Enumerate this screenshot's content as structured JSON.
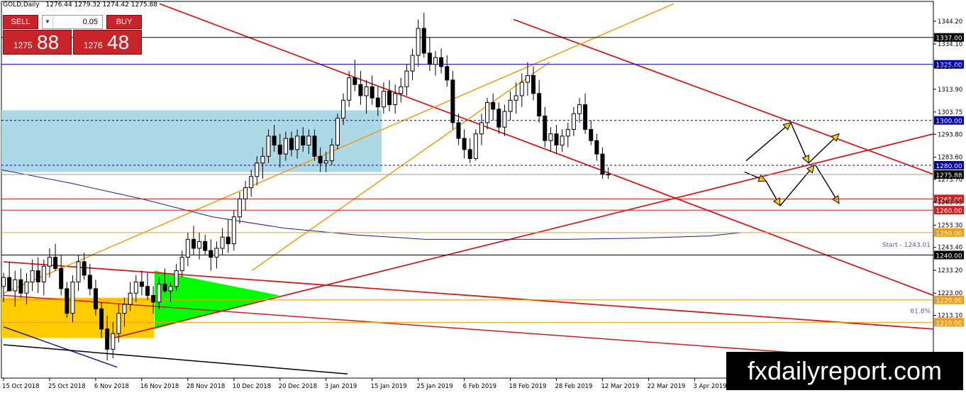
{
  "header": {
    "symbol_tf": "GOLD,Daily",
    "ohlc": "1276.44 1279.32 1274.42 1275.88"
  },
  "trade_panel": {
    "sell_label": "SELL",
    "buy_label": "BUY",
    "lot": "0.05",
    "sell_small": "1275",
    "sell_big": "88",
    "buy_small": "1276",
    "buy_big": "48",
    "down_arrow": "▼",
    "up_arrow": "▲"
  },
  "watermark": "fxdailyreport.com",
  "colors": {
    "bull": "#ffffff",
    "bear": "#000000",
    "red": "#d41c1c",
    "orange": "#f39c12",
    "navy": "#1c1c9c",
    "zone": "#add8e6",
    "green": "#00ff00",
    "yellow": "#ffcc00"
  },
  "chart_data": {
    "type": "candlestick",
    "ylim": [
      1185.13,
      1353.04
    ],
    "y_ticks": [
      "1344.20",
      "1334.10",
      "1323.95",
      "1313.90",
      "1303.75",
      "1293.80",
      "1283.60",
      "1273.70",
      "1263.55",
      "1253.30",
      "1243.40",
      "1233.20",
      "1223.00",
      "1213.10"
    ],
    "x_labels": [
      "15 Oct 2018",
      "25 Oct 2018",
      "6 Nov 2018",
      "16 Nov 2018",
      "28 Nov 2018",
      "10 Dec 2018",
      "20 Dec 2018",
      "3 Jan 2019",
      "15 Jan 2019",
      "25 Jan 2019",
      "6 Feb 2019",
      "18 Feb 2019",
      "28 Feb 2019",
      "12 Mar 2019",
      "22 Mar 2019",
      "3 Apr 2019"
    ],
    "x_label_index": [
      0,
      8,
      16,
      24,
      32,
      40,
      48,
      56,
      64,
      72,
      80,
      88,
      96,
      104,
      112,
      120
    ],
    "levels": [
      {
        "price": 1337.0,
        "label": "1337.00",
        "color": "#000000",
        "style": "solid"
      },
      {
        "price": 1325.0,
        "label": "1325.00",
        "color": "#0000cc",
        "style": "solid"
      },
      {
        "price": 1300.0,
        "label": "1300.00",
        "color": "#0000aa",
        "style": "dash"
      },
      {
        "price": 1280.0,
        "label": "1280.00",
        "color": "#0000aa",
        "style": "dash"
      },
      {
        "price": 1275.88,
        "label": "1275.88",
        "color": "#000000",
        "style": "current"
      },
      {
        "price": 1265.0,
        "label": "1265.00",
        "color": "#d41c1c",
        "style": "solid"
      },
      {
        "price": 1260.0,
        "label": "1260.00",
        "color": "#d41c1c",
        "style": "solid"
      },
      {
        "price": 1250.0,
        "label": "1250.00",
        "color": "#f39c12",
        "style": "solid"
      },
      {
        "price": 1240.0,
        "label": "1240.00",
        "color": "#000000",
        "style": "solid"
      },
      {
        "price": 1220.0,
        "label": "1220.00",
        "color": "#f39c12",
        "style": "solid"
      },
      {
        "price": 1210.0,
        "label": "1210.00",
        "color": "#f39c12",
        "style": "solid"
      }
    ],
    "annotations": [
      {
        "text": "Start - 1243.01",
        "price": 1243.01
      },
      {
        "text": "61.8%",
        "price": 1213.5
      }
    ],
    "candles": [
      [
        1226,
        1232,
        1219,
        1230
      ],
      [
        1230,
        1237,
        1226,
        1224
      ],
      [
        1224,
        1233,
        1217,
        1229
      ],
      [
        1229,
        1234,
        1221,
        1223
      ],
      [
        1223,
        1232,
        1218,
        1228
      ],
      [
        1228,
        1238,
        1224,
        1233
      ],
      [
        1233,
        1239,
        1223,
        1228
      ],
      [
        1228,
        1238,
        1222,
        1235
      ],
      [
        1235,
        1243,
        1230,
        1239
      ],
      [
        1239,
        1245,
        1233,
        1234
      ],
      [
        1234,
        1240,
        1222,
        1225
      ],
      [
        1225,
        1228,
        1212,
        1214
      ],
      [
        1214,
        1231,
        1210,
        1228
      ],
      [
        1228,
        1240,
        1224,
        1237
      ],
      [
        1237,
        1241,
        1229,
        1231
      ],
      [
        1231,
        1236,
        1222,
        1225
      ],
      [
        1225,
        1229,
        1213,
        1216
      ],
      [
        1216,
        1219,
        1203,
        1207
      ],
      [
        1207,
        1213,
        1193,
        1198
      ],
      [
        1198,
        1210,
        1194,
        1205
      ],
      [
        1205,
        1218,
        1201,
        1214
      ],
      [
        1214,
        1221,
        1208,
        1218
      ],
      [
        1218,
        1228,
        1215,
        1223
      ],
      [
        1223,
        1231,
        1219,
        1228
      ],
      [
        1228,
        1233,
        1222,
        1226
      ],
      [
        1226,
        1232,
        1220,
        1222
      ],
      [
        1222,
        1226,
        1214,
        1219
      ],
      [
        1219,
        1230,
        1216,
        1227
      ],
      [
        1227,
        1234,
        1223,
        1224
      ],
      [
        1224,
        1228,
        1219,
        1226
      ],
      [
        1226,
        1236,
        1224,
        1233
      ],
      [
        1233,
        1242,
        1230,
        1239
      ],
      [
        1239,
        1250,
        1235,
        1247
      ],
      [
        1247,
        1253,
        1240,
        1243
      ],
      [
        1243,
        1250,
        1238,
        1246
      ],
      [
        1246,
        1249,
        1240,
        1242
      ],
      [
        1242,
        1247,
        1233,
        1239
      ],
      [
        1239,
        1246,
        1234,
        1243
      ],
      [
        1243,
        1252,
        1240,
        1248
      ],
      [
        1248,
        1256,
        1241,
        1245
      ],
      [
        1245,
        1260,
        1242,
        1257
      ],
      [
        1257,
        1268,
        1254,
        1265
      ],
      [
        1265,
        1273,
        1260,
        1270
      ],
      [
        1270,
        1278,
        1266,
        1275
      ],
      [
        1275,
        1284,
        1271,
        1281
      ],
      [
        1281,
        1288,
        1274,
        1284
      ],
      [
        1284,
        1296,
        1281,
        1293
      ],
      [
        1293,
        1298,
        1286,
        1289
      ],
      [
        1289,
        1294,
        1279,
        1285
      ],
      [
        1285,
        1295,
        1282,
        1292
      ],
      [
        1292,
        1295,
        1284,
        1287
      ],
      [
        1287,
        1296,
        1283,
        1293
      ],
      [
        1293,
        1297,
        1286,
        1289
      ],
      [
        1289,
        1296,
        1285,
        1293
      ],
      [
        1293,
        1296,
        1282,
        1284
      ],
      [
        1284,
        1288,
        1277,
        1281
      ],
      [
        1281,
        1286,
        1277,
        1282
      ],
      [
        1282,
        1292,
        1280,
        1289
      ],
      [
        1289,
        1303,
        1287,
        1301
      ],
      [
        1301,
        1312,
        1298,
        1309
      ],
      [
        1309,
        1322,
        1306,
        1319
      ],
      [
        1319,
        1327,
        1313,
        1316
      ],
      [
        1316,
        1322,
        1307,
        1311
      ],
      [
        1311,
        1318,
        1303,
        1315
      ],
      [
        1315,
        1320,
        1307,
        1310
      ],
      [
        1310,
        1315,
        1302,
        1306
      ],
      [
        1306,
        1317,
        1303,
        1313
      ],
      [
        1313,
        1318,
        1304,
        1307
      ],
      [
        1307,
        1316,
        1303,
        1312
      ],
      [
        1312,
        1319,
        1308,
        1315
      ],
      [
        1315,
        1325,
        1311,
        1322
      ],
      [
        1322,
        1332,
        1318,
        1329
      ],
      [
        1329,
        1345,
        1324,
        1341
      ],
      [
        1341,
        1348,
        1328,
        1330
      ],
      [
        1330,
        1337,
        1322,
        1325
      ],
      [
        1325,
        1331,
        1320,
        1328
      ],
      [
        1328,
        1332,
        1321,
        1324
      ],
      [
        1324,
        1329,
        1315,
        1318
      ],
      [
        1318,
        1322,
        1296,
        1299
      ],
      [
        1299,
        1303,
        1289,
        1292
      ],
      [
        1292,
        1296,
        1283,
        1287
      ],
      [
        1287,
        1292,
        1281,
        1283
      ],
      [
        1283,
        1296,
        1282,
        1294
      ],
      [
        1294,
        1303,
        1289,
        1299
      ],
      [
        1299,
        1310,
        1296,
        1308
      ],
      [
        1308,
        1312,
        1300,
        1305
      ],
      [
        1305,
        1308,
        1294,
        1297
      ],
      [
        1297,
        1307,
        1293,
        1304
      ],
      [
        1304,
        1313,
        1300,
        1309
      ],
      [
        1309,
        1317,
        1303,
        1311
      ],
      [
        1311,
        1321,
        1306,
        1317
      ],
      [
        1317,
        1326,
        1311,
        1320
      ],
      [
        1320,
        1324,
        1309,
        1312
      ],
      [
        1312,
        1318,
        1299,
        1302
      ],
      [
        1302,
        1306,
        1288,
        1291
      ],
      [
        1291,
        1297,
        1286,
        1294
      ],
      [
        1294,
        1298,
        1285,
        1289
      ],
      [
        1289,
        1296,
        1286,
        1293
      ],
      [
        1293,
        1299,
        1288,
        1296
      ],
      [
        1296,
        1306,
        1293,
        1303
      ],
      [
        1303,
        1310,
        1299,
        1307
      ],
      [
        1307,
        1312,
        1294,
        1296
      ],
      [
        1296,
        1300,
        1289,
        1291
      ],
      [
        1291,
        1294,
        1282,
        1285
      ],
      [
        1285,
        1288,
        1274,
        1276
      ],
      [
        1276,
        1279,
        1274,
        1275.88
      ]
    ]
  }
}
